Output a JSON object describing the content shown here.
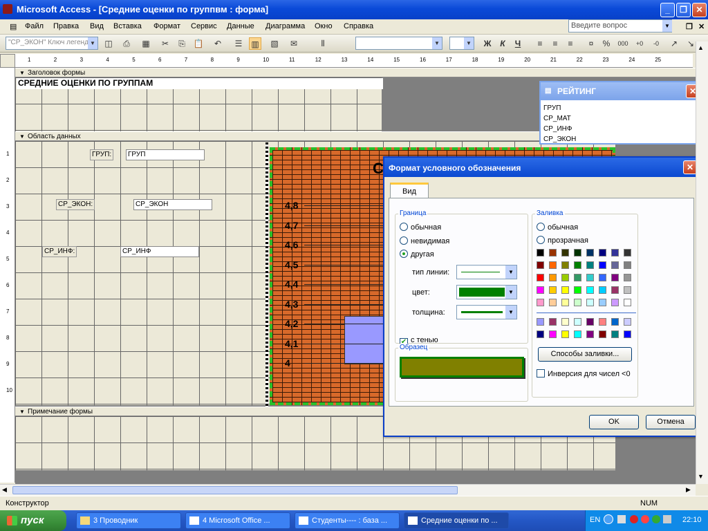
{
  "window": {
    "title": "Microsoft Access - [Средние оценки по группвм : форма]"
  },
  "menu": [
    "Файл",
    "Правка",
    "Вид",
    "Вставка",
    "Формат",
    "Сервис",
    "Данные",
    "Диаграмма",
    "Окно",
    "Справка"
  ],
  "help_placeholder": "Введите вопрос",
  "toolbar": {
    "object_combo": "\"СР_ЭКОН\" Ключ легенды",
    "bold": "Ж",
    "italic": "К",
    "underline": "Ч"
  },
  "ruler": {
    "top": [
      "1",
      "2",
      "3",
      "4",
      "5",
      "6",
      "7",
      "8",
      "9",
      "10",
      "11",
      "12",
      "13",
      "14",
      "15",
      "16",
      "17",
      "18",
      "19",
      "20",
      "21",
      "22",
      "23",
      "24",
      "25"
    ],
    "left": [
      "1",
      "2",
      "3",
      "4",
      "5",
      "6",
      "7",
      "8",
      "9",
      "10"
    ]
  },
  "form": {
    "header_section": "Заголовок формы",
    "title": "СРЕДНИЕ ОЦЕНКИ ПО ГРУППАМ",
    "detail_section": "Область данных",
    "footer_section": "Примечание формы",
    "fields": [
      {
        "label": "ГРУП:",
        "value": "ГРУП"
      },
      {
        "label": "СР_ЭКОН:",
        "value": "СР_ЭКОН"
      },
      {
        "label": "СР_ИНФ:",
        "value": "СР_ИНФ"
      }
    ],
    "chart_letter": "С",
    "chart_y_ticks": [
      "4,8",
      "4,7",
      "4,6",
      "4,5",
      "4,4",
      "4,3",
      "4,2",
      "4,1",
      "4"
    ]
  },
  "rating_window": {
    "title": "РЕЙТИНГ",
    "items": [
      "ГРУП",
      "СР_МАТ",
      "СР_ИНФ",
      "СР_ЭКОН"
    ]
  },
  "dialog": {
    "title": "Формат условного обозначения",
    "tab": "Вид",
    "border_group": "Граница",
    "border_options": [
      "обычная",
      "невидимая",
      "другая"
    ],
    "line_type_label": "тип линии:",
    "color_label": "цвет:",
    "weight_label": "толщина:",
    "shadow_label": "с тенью",
    "sample_group": "Образец",
    "fill_group": "Заливка",
    "fill_options": [
      "обычная",
      "прозрачная"
    ],
    "fill_methods_button": "Способы заливки...",
    "invert_label": "Инверсия для чисел <0",
    "ok": "OK",
    "cancel": "Отмена",
    "palette": [
      [
        "#000000",
        "#993300",
        "#333300",
        "#003300",
        "#003366",
        "#000080",
        "#333399",
        "#333333"
      ],
      [
        "#800000",
        "#ff6600",
        "#808000",
        "#008000",
        "#008080",
        "#0000ff",
        "#666699",
        "#808080"
      ],
      [
        "#ff0000",
        "#ff9900",
        "#99cc00",
        "#339966",
        "#33cccc",
        "#3366ff",
        "#800080",
        "#969696"
      ],
      [
        "#ff00ff",
        "#ffcc00",
        "#ffff00",
        "#00ff00",
        "#00ffff",
        "#00ccff",
        "#993366",
        "#c0c0c0"
      ],
      [
        "#ff99cc",
        "#ffcc99",
        "#ffff99",
        "#ccffcc",
        "#ccffff",
        "#99ccff",
        "#cc99ff",
        "#ffffff"
      ]
    ],
    "palette_extra": [
      [
        "#9999ff",
        "#993366",
        "#ffffcc",
        "#ccffff",
        "#660066",
        "#ff8080",
        "#0066cc",
        "#ccccff"
      ],
      [
        "#000080",
        "#ff00ff",
        "#ffff00",
        "#00ffff",
        "#800080",
        "#800000",
        "#008080",
        "#0000ff"
      ]
    ]
  },
  "status": {
    "left": "Конструктор",
    "right": "NUM"
  },
  "taskbar": {
    "start": "пуск",
    "tasks": [
      "3 Проводник",
      "4 Microsoft Office ...",
      "Студенты---- : база ...",
      "Средние оценки по ..."
    ],
    "lang": "EN",
    "clock": "22:10"
  }
}
